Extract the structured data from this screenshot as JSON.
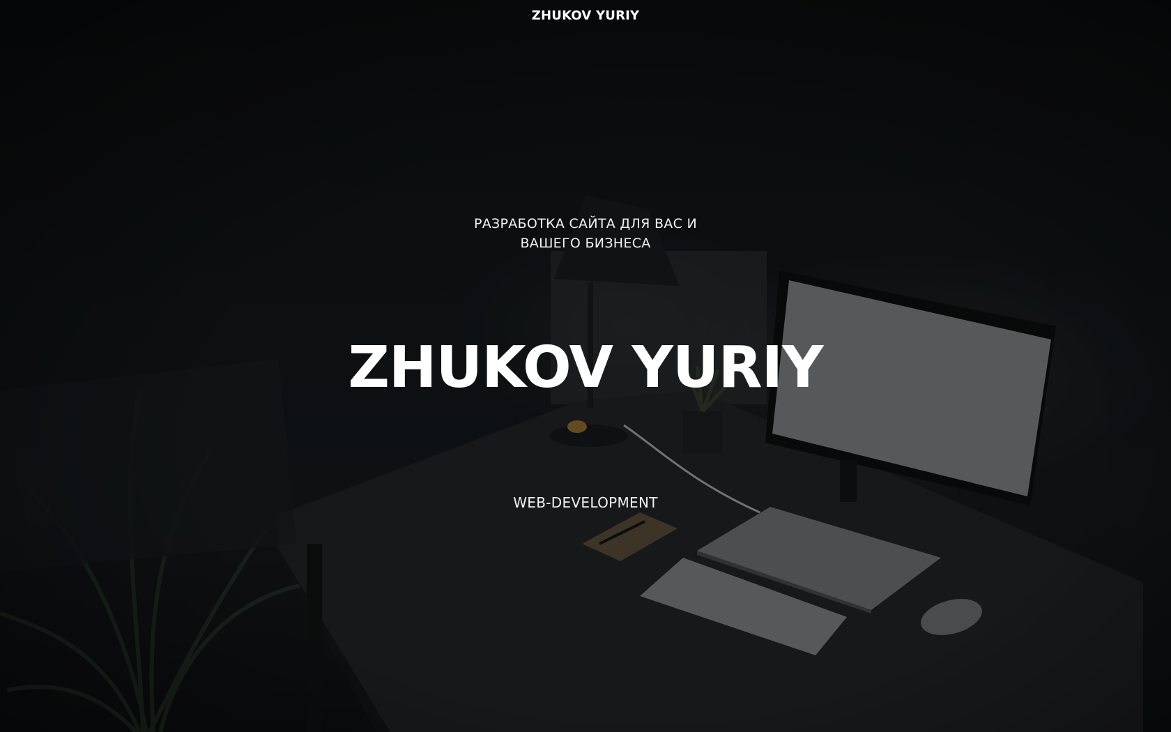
{
  "header": {
    "brand": "ZHUKOV YURIY"
  },
  "hero": {
    "tagline_line1": "РАЗРАБОТКА САЙТА ДЛЯ ВАС И",
    "tagline_line2": "ВАШЕГО БИЗНЕСА",
    "title": "ZHUKOV YURIY",
    "subtitle": "WEB-DEVELOPMENT"
  },
  "colors": {
    "background": "#0b0d0f",
    "text": "#ffffff"
  }
}
